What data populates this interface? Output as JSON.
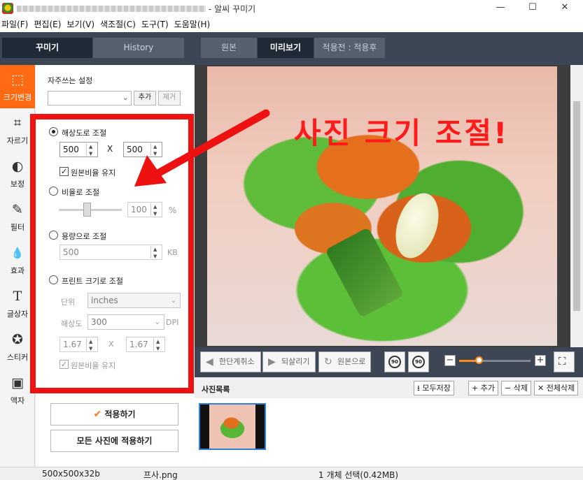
{
  "window": {
    "title": "- 알씨 꾸미기",
    "minimize": "—",
    "maximize": "☐",
    "close": "✕"
  },
  "menu": [
    "파일(F)",
    "편집(E)",
    "보기(V)",
    "색조절(C)",
    "도구(T)",
    "도움말(H)"
  ],
  "left_tabs": {
    "decorate": "꾸미기",
    "history": "History"
  },
  "view_tabs": {
    "original": "원본",
    "preview": "미리보기",
    "before_after": "적용전 : 적용후"
  },
  "tools": [
    {
      "label": "크기변경",
      "icon": "resize-icon",
      "glyph": "⬚"
    },
    {
      "label": "자르기",
      "icon": "crop-icon",
      "glyph": "⌗"
    },
    {
      "label": "보정",
      "icon": "contrast-icon",
      "glyph": "◐"
    },
    {
      "label": "필터",
      "icon": "filter-brush-icon",
      "glyph": "✎"
    },
    {
      "label": "효과",
      "icon": "drop-icon",
      "glyph": "💧"
    },
    {
      "label": "글상자",
      "icon": "text-icon",
      "glyph": "T"
    },
    {
      "label": "스티커",
      "icon": "star-sticker-icon",
      "glyph": "✪"
    },
    {
      "label": "액자",
      "icon": "picture-frame-icon",
      "glyph": "▣"
    }
  ],
  "settings": {
    "favorites_label": "자주쓰는 설정",
    "favorites_value": "",
    "add": "추가",
    "remove": "제거",
    "by_resolution": "해상도로 조절",
    "width": "500",
    "times": "X",
    "height": "500",
    "keep_ratio": "원본비율 유지",
    "by_ratio": "비율로 조절",
    "ratio_value": "100",
    "percent": "%",
    "by_size": "용량으로 조절",
    "size_value": "500",
    "kb": "KB",
    "by_print": "프린트 크기로 조절",
    "unit_label": "단위",
    "unit_value": "inches",
    "dpi_label": "해상도",
    "dpi_value": "300",
    "dpi_unit": "DPI",
    "print_w": "1.67",
    "print_h": "1.67",
    "print_keep_ratio": "원본비율 유지",
    "apply": "적용하기",
    "apply_all": "모든 사진에 적용하기"
  },
  "preview": {
    "overlay": "사진 크기 조절!"
  },
  "actions": {
    "undo": "한단계취소",
    "redo": "되살리기",
    "to_original": "원본으로",
    "rotate_left": "90",
    "rotate_right": "90"
  },
  "photo_list": {
    "title": "사진목록",
    "save_all": "모두저장",
    "add": "+ 추가",
    "delete": "− 삭제",
    "delete_all": "✕ 전체삭제"
  },
  "status": {
    "dimensions": "500x500x32b",
    "filename": "프사.png",
    "selection": "1 개체 선택(0.42MB)"
  }
}
